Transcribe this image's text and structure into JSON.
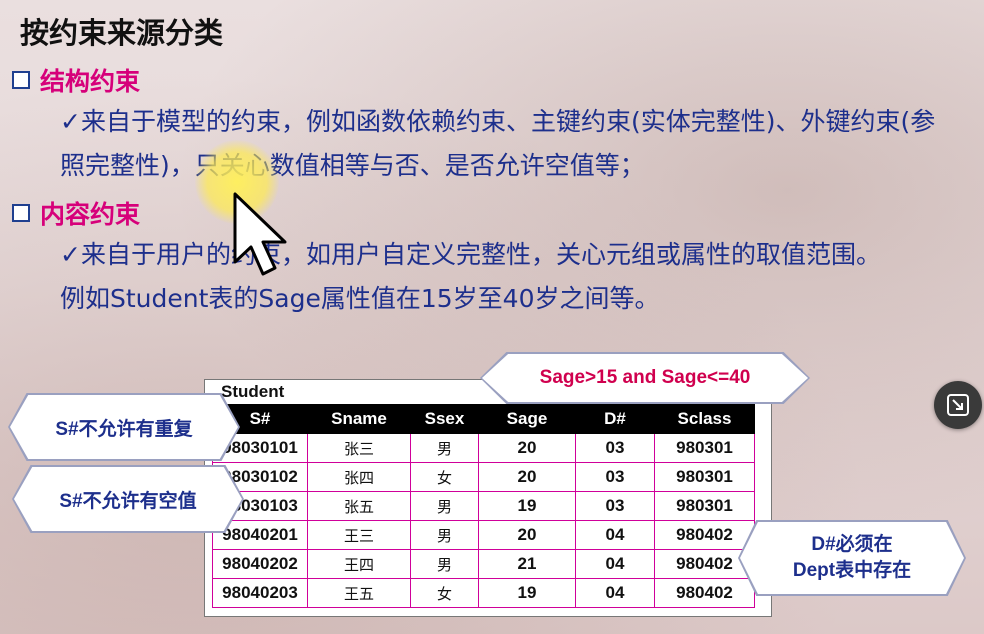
{
  "slide": {
    "title": "按约束来源分类",
    "section1": {
      "heading": "结构约束",
      "text": "✓来自于模型的约束，例如函数依赖约束、主键约束(实体完整性)、外键约束(参照完整性)，只关心数值相等与否、是否允许空值等；"
    },
    "section2": {
      "heading": "内容约束",
      "text_line1": "✓来自于用户的约束，如用户自定义完整性，关心元组或属性的取值范围。",
      "text_line2": "例如Student表的Sage属性值在15岁至40岁之间等。"
    }
  },
  "table": {
    "caption": "Student",
    "headers": [
      "S#",
      "Sname",
      "Ssex",
      "Sage",
      "D#",
      "Sclass"
    ],
    "rows": [
      [
        "98030101",
        "张三",
        "男",
        "20",
        "03",
        "980301"
      ],
      [
        "98030102",
        "张四",
        "女",
        "20",
        "03",
        "980301"
      ],
      [
        "98030103",
        "张五",
        "男",
        "19",
        "03",
        "980301"
      ],
      [
        "98040201",
        "王三",
        "男",
        "20",
        "04",
        "980402"
      ],
      [
        "98040202",
        "王四",
        "男",
        "21",
        "04",
        "980402"
      ],
      [
        "98040203",
        "王五",
        "女",
        "19",
        "04",
        "980402"
      ]
    ]
  },
  "callouts": {
    "sage": "Sage>15 and Sage<=40",
    "no_duplicate": "S#不允许有重复",
    "no_null": "S#不允许有空值",
    "dept_line1": "D#必须在",
    "dept_line2": "Dept表中存在"
  },
  "icons": {
    "cursor": "arrow-cursor-icon",
    "fab": "exit-fullscreen-icon"
  },
  "colors": {
    "heading": "#d6007a",
    "body_text": "#1d2f8c",
    "table_border": "#d0009a"
  }
}
